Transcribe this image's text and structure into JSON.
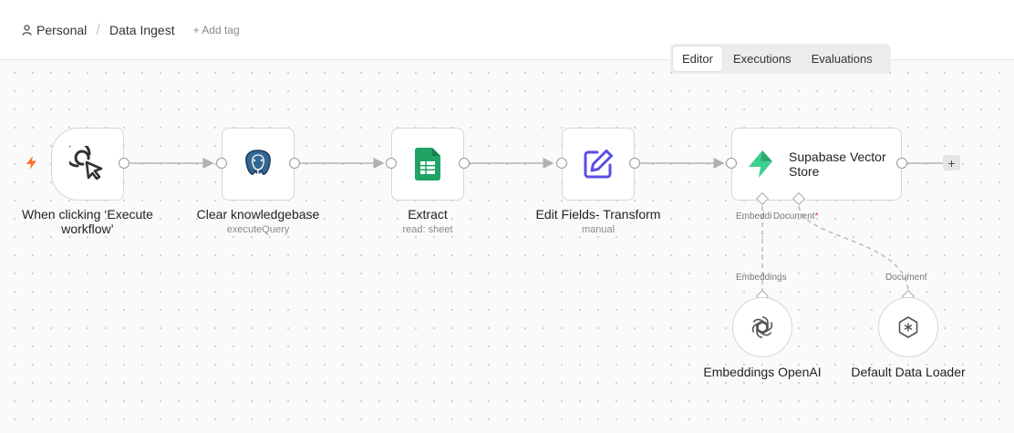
{
  "breadcrumb": {
    "project": "Personal",
    "workflow": "Data Ingest",
    "add_tag": "+ Add tag"
  },
  "tabs": [
    {
      "label": "Editor",
      "active": true
    },
    {
      "label": "Executions",
      "active": false
    },
    {
      "label": "Evaluations",
      "active": false
    }
  ],
  "nodes": {
    "trigger": {
      "title": "When clicking ‘Execute workflow’",
      "icon": "cursor-click-icon"
    },
    "clear": {
      "title": "Clear knowledgebase",
      "subtitle": "executeQuery",
      "icon": "postgres-icon"
    },
    "extract": {
      "title": "Extract",
      "subtitle": "read: sheet",
      "icon": "google-sheets-icon"
    },
    "edit": {
      "title": "Edit Fields- Transform",
      "subtitle": "manual",
      "icon": "edit-pencil-icon"
    },
    "supabase": {
      "title": "Supabase Vector Store",
      "icon": "supabase-icon"
    },
    "embeddings": {
      "title": "Embeddings OpenAI",
      "icon": "openai-icon"
    },
    "loader": {
      "title": "Default Data Loader",
      "icon": "data-loader-icon"
    }
  },
  "ports": {
    "supabase_embedding": "Embeddi",
    "supabase_document": "Document",
    "required_marker": "*",
    "embeddings_out": "Embeddings",
    "loader_out": "Document"
  },
  "add_node": "+",
  "colors": {
    "trigger_bolt": "#ff6d2d",
    "sheets_green": "#21a366",
    "edit_purple": "#5a4ee6",
    "supabase_green": "#3ecf8e",
    "postgres_blue": "#336791"
  }
}
